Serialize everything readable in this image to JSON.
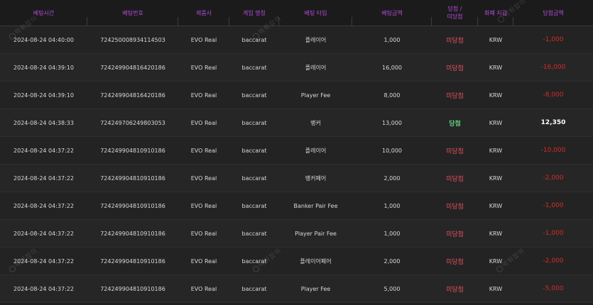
{
  "table": {
    "headers": [
      "베팅시간",
      "베팅번호",
      "제품사",
      "게임 명칭",
      "베팅 타입",
      "베팅금액",
      "당첨 /\n미당첨",
      "화폐 지갑",
      "당첨금액"
    ],
    "rows": [
      {
        "time": "2024-08-24 04:40:00",
        "bet_id": "724250008934114503",
        "provider": "EVO Real",
        "game": "baccarat",
        "bet_type": "플레이어",
        "bet_amount": "1,000",
        "result": "미당첨",
        "currency": "KRW",
        "payout": "-1,000"
      },
      {
        "time": "2024-08-24 04:39:10",
        "bet_id": "724249904816420186",
        "provider": "EVO Real",
        "game": "baccarat",
        "bet_type": "플레이어",
        "bet_amount": "16,000",
        "result": "미당첨",
        "currency": "KRW",
        "payout": "-16,000"
      },
      {
        "time": "2024-08-24 04:39:10",
        "bet_id": "724249904816420186",
        "provider": "EVO Real",
        "game": "baccarat",
        "bet_type": "Player Fee",
        "bet_amount": "8,000",
        "result": "미당첨",
        "currency": "KRW",
        "payout": "-8,000"
      },
      {
        "time": "2024-08-24 04:38:33",
        "bet_id": "724249706249803053",
        "provider": "EVO Real",
        "game": "baccarat",
        "bet_type": "뱅커",
        "bet_amount": "13,000",
        "result": "당첨",
        "currency": "KRW",
        "payout": "12,350"
      },
      {
        "time": "2024-08-24 04:37:22",
        "bet_id": "724249904810910186",
        "provider": "EVO Real",
        "game": "baccarat",
        "bet_type": "플레이어",
        "bet_amount": "10,000",
        "result": "미당첨",
        "currency": "KRW",
        "payout": "-10,000"
      },
      {
        "time": "2024-08-24 04:37:22",
        "bet_id": "724249904810910186",
        "provider": "EVO Real",
        "game": "baccarat",
        "bet_type": "뱅커페어",
        "bet_amount": "2,000",
        "result": "미당첨",
        "currency": "KRW",
        "payout": "-2,000"
      },
      {
        "time": "2024-08-24 04:37:22",
        "bet_id": "724249904810910186",
        "provider": "EVO Real",
        "game": "baccarat",
        "bet_type": "Banker Pair Fee",
        "bet_amount": "1,000",
        "result": "미당첨",
        "currency": "KRW",
        "payout": "-1,000"
      },
      {
        "time": "2024-08-24 04:37:22",
        "bet_id": "724249904810910186",
        "provider": "EVO Real",
        "game": "baccarat",
        "bet_type": "Player Pair Fee",
        "bet_amount": "1,000",
        "result": "미당첨",
        "currency": "KRW",
        "payout": "-1,000"
      },
      {
        "time": "2024-08-24 04:37:22",
        "bet_id": "724249904810910186",
        "provider": "EVO Real",
        "game": "baccarat",
        "bet_type": "플레이어페어",
        "bet_amount": "2,000",
        "result": "미당첨",
        "currency": "KRW",
        "payout": "-2,000"
      },
      {
        "time": "2024-08-24 04:37:22",
        "bet_id": "724249904810910186",
        "provider": "EVO Real",
        "game": "baccarat",
        "bet_type": "Player Fee",
        "bet_amount": "5,000",
        "result": "미당첨",
        "currency": "KRW",
        "payout": "-5,000"
      }
    ]
  },
  "watermark": {
    "text": "먹튀잡이"
  },
  "colors": {
    "header_text": "#b44bdb",
    "lose_text": "#e8505d",
    "lose_amount": "#d92a2a",
    "win_text": "#66d08a",
    "win_amount": "#ffffff",
    "background": "#1e1e1e"
  }
}
